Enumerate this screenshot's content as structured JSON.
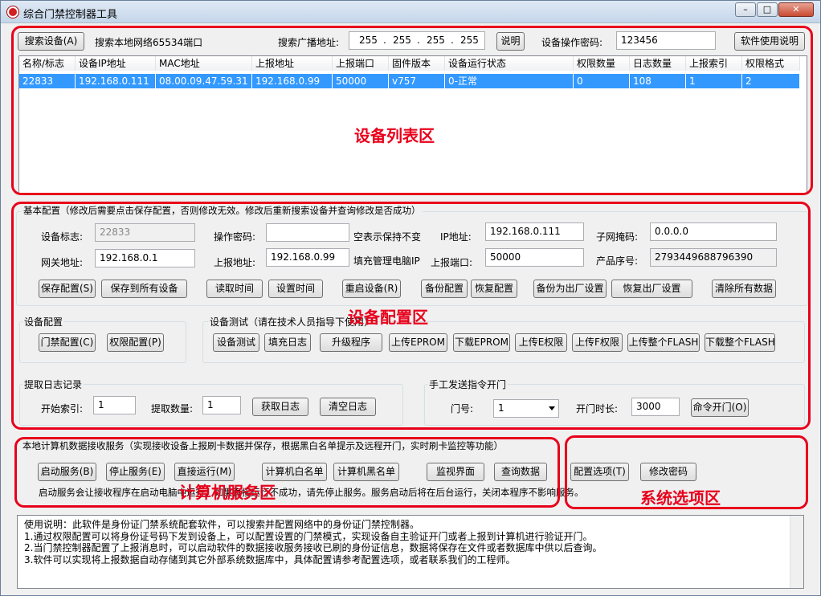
{
  "window": {
    "title": "综合门禁控制器工具"
  },
  "top": {
    "search_button": "搜索设备(A)",
    "search_info": "搜索本地网络65534端口",
    "broadcast_label": "搜索广播地址:",
    "ip_octets": [
      "255",
      "255",
      "255",
      "255"
    ],
    "explain_button": "说明",
    "password_label": "设备操作密码:",
    "password_value": "123456",
    "manual_button": "软件使用说明"
  },
  "grid": {
    "columns": [
      "名称/标志",
      "设备IP地址",
      "MAC地址",
      "上报地址",
      "上报端口",
      "固件版本",
      "设备运行状态",
      "权限数量",
      "日志数量",
      "上报索引",
      "权限格式"
    ],
    "rows": [
      [
        "22833",
        "192.168.0.111",
        "08.00.09.47.59.31",
        "192.168.0.99",
        "50000",
        "v757",
        "0-正常",
        "0",
        "108",
        "1",
        "2"
      ]
    ]
  },
  "annotations": {
    "device_list": "设备列表区",
    "device_config": "设备配置区",
    "pc_service": "计算机服务区",
    "system_options": "系统选项区"
  },
  "basic": {
    "title": "基本配置（修改后需要点击保存配置，否则修改无效。修改后重新搜索设备并查询修改是否成功）",
    "device_id_label": "设备标志:",
    "device_id_value": "22833",
    "op_password_label": "操作密码:",
    "op_password_value": "",
    "blank_hint": "空表示保持不变",
    "ip_label": "IP地址:",
    "ip_value": "192.168.0.111",
    "mask_label": "子网掩码:",
    "mask_value": "0.0.0.0",
    "gateway_label": "网关地址:",
    "gateway_value": "192.168.0.1",
    "report_addr_label": "上报地址:",
    "report_addr_value": "192.168.0.99",
    "fill_ip_label": "填充管理电脑IP",
    "report_port_label": "上报端口:",
    "report_port_value": "50000",
    "serial_label": "产品序号:",
    "serial_value": "2793449688796390",
    "buttons": [
      "保存配置(S)",
      "保存到所有设备",
      "读取时间",
      "设置时间",
      "重启设备(R)",
      "备份配置",
      "恢复配置",
      "备份为出厂设置",
      "恢复出厂设置",
      "清除所有数据"
    ]
  },
  "device_cfg": {
    "title": "设备配置",
    "buttons": [
      "门禁配置(C)",
      "权限配置(P)"
    ]
  },
  "device_test": {
    "title": "设备测试（请在技术人员指导下使用）",
    "buttons": [
      "设备测试",
      "填充日志",
      "升级程序",
      "上传EPROM",
      "下载EPROM",
      "上传E权限",
      "上传F权限",
      "上传整个FLASH",
      "下载整个FLASH"
    ]
  },
  "log": {
    "title": "提取日志记录",
    "start_label": "开始索引:",
    "start_value": "1",
    "count_label": "提取数量:",
    "count_value": "1",
    "buttons": [
      "获取日志",
      "清空日志"
    ]
  },
  "door": {
    "title": "手工发送指令开门",
    "door_label": "门号:",
    "door_value": "1",
    "duration_label": "开门时长:",
    "duration_value": "3000",
    "open_button": "命令开门(O)"
  },
  "service": {
    "title": "本地计算机数据接收服务（实现接收设备上报刷卡数据并保存，根据黑白名单提示及远程开门，实时刷卡监控等功能）",
    "buttons": [
      "启动服务(B)",
      "停止服务(E)",
      "直接运行(M)",
      "计算机白名单",
      "计算机黑名单",
      "监视界面",
      "查询数据"
    ],
    "note": "启动服务会让接收程序在启动电脑中运行，如果直接运行不成功，请先停止服务。服务启动后将在后台运行，关闭本程序不影响服务。"
  },
  "sysopt": {
    "buttons": [
      "配置选项(T)",
      "修改密码"
    ]
  },
  "usage": {
    "lines": [
      "使用说明：此软件是身份证门禁系统配套软件，可以搜索并配置网络中的身份证门禁控制器。",
      "1.通过权限配置可以将身份证号码下发到设备上，可以配置设置的门禁模式，实现设备自主验证开门或者上报到计算机进行验证开门。",
      "2.当门禁控制器配置了上报消息时，可以启动软件的数据接收服务接收已刷的身份证信息，数据将保存在文件或者数据库中供以后查询。",
      "3.软件可以实现将上报数据自动存储到其它外部系统数据库中，具体配置请参考配置选项，或者联系我们的工程师。"
    ]
  },
  "colors": {
    "annotation": "#e8001b",
    "selection": "#3399ff"
  }
}
